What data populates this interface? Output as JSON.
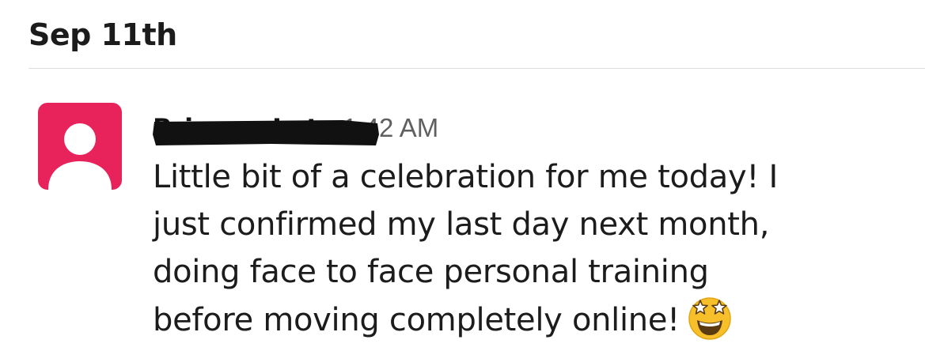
{
  "date_divider": {
    "label": "Sep 11th"
  },
  "message": {
    "sender_name": "Brianna Lutz",
    "timestamp": "1:42 AM",
    "lines": [
      "Little bit of a celebration for me today! I",
      "just confirmed my last day next month,",
      "doing face to face personal training",
      "before moving completely online!"
    ],
    "emoji": "star-struck-emoji",
    "avatar_color": "#e8225a"
  }
}
